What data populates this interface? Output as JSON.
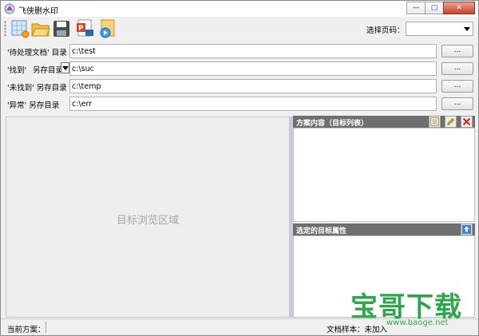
{
  "window": {
    "title": "飞侠删水印",
    "minimize_glyph": "—",
    "maximize_glyph": "▢",
    "close_glyph": "✕"
  },
  "toolbar": {
    "buttons": [
      {
        "icon": "new-scheme-icon"
      },
      {
        "icon": "open-folder-icon"
      },
      {
        "icon": "save-icon"
      },
      {
        "icon": "powerpoint-process-icon"
      },
      {
        "icon": "run-batch-icon"
      }
    ],
    "page_label": "选择页码：",
    "page_value": ""
  },
  "dirs": {
    "pending": {
      "label": "'待处理文档' 目录",
      "required_mark": "*",
      "path": "c:\\test",
      "browse": "..."
    },
    "found": {
      "label": "'找到'",
      "option": "另存目录",
      "path": "c:\\suc",
      "browse": "..."
    },
    "notfound": {
      "label": "'未找到' 另存目录",
      "path": "c:\\temp",
      "browse": "..."
    },
    "error": {
      "label": "'异常'  另存目录",
      "path": "c:\\err",
      "browse": "..."
    }
  },
  "preview": {
    "placeholder": "目标浏览区域"
  },
  "scheme_panel": {
    "title": "方案内容（目标列表）",
    "buttons": [
      "list-icon",
      "edit-icon",
      "delete-icon"
    ]
  },
  "props_panel": {
    "title": "选定的目标属性",
    "buttons": [
      "upload-icon"
    ]
  },
  "status": {
    "current_scheme": "当前方案：",
    "sample": "文档样本：未加入"
  },
  "watermark": {
    "text": "宝哥下载",
    "url": "www.baoge.net"
  },
  "colors": {
    "accent_green": "#2ea64b",
    "panel_header": "#6f6f6f",
    "required": "#d00000"
  }
}
